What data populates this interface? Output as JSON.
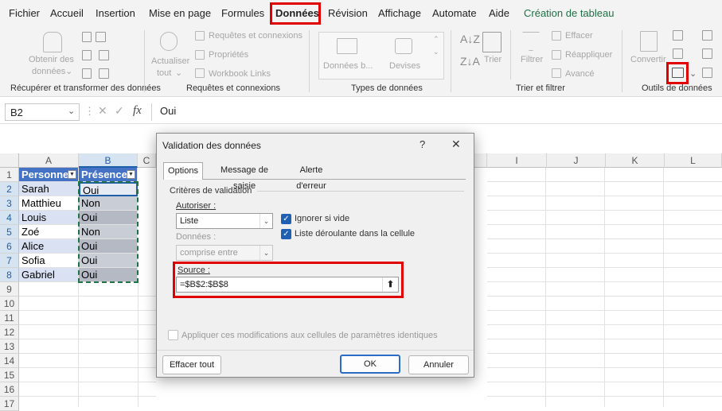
{
  "menu": {
    "items": [
      "Fichier",
      "Accueil",
      "Insertion",
      "Mise en page",
      "Formules",
      "Données",
      "Révision",
      "Affichage",
      "Automate",
      "Aide",
      "Création de tableau"
    ],
    "active": "Données"
  },
  "ribbon": {
    "get_data": "Obtenir des",
    "get_data2": "données",
    "refresh": "Actualiser",
    "refresh2": "tout",
    "queries": "Requêtes et connexions",
    "properties": "Propriétés",
    "workbook_links": "Workbook Links",
    "stocks": "Données b...",
    "currencies": "Devises",
    "sort": "Trier",
    "filter": "Filtrer",
    "clear": "Effacer",
    "reapply": "Réappliquer",
    "advanced": "Avancé",
    "convert": "Convertir",
    "groups": {
      "get_transform": "Récupérer et transformer des données",
      "queries": "Requêtes et connexions",
      "data_types": "Types de données",
      "sort_filter": "Trier et filtrer",
      "data_tools": "Outils de données"
    }
  },
  "formula_bar": {
    "name_box": "B2",
    "fx": "fx",
    "value": "Oui"
  },
  "grid": {
    "columns": [
      "A",
      "B",
      "C",
      "D",
      "E",
      "F",
      "G",
      "H",
      "I",
      "J",
      "K",
      "L"
    ],
    "rows": [
      "1",
      "2",
      "3",
      "4",
      "5",
      "6",
      "7",
      "8",
      "9",
      "10",
      "11",
      "12",
      "13",
      "14",
      "15",
      "16",
      "17"
    ],
    "header": [
      "Personne",
      "Présence"
    ],
    "data": [
      [
        "Sarah",
        "Oui"
      ],
      [
        "Matthieu",
        "Non"
      ],
      [
        "Louis",
        "Oui"
      ],
      [
        "Zoé",
        "Non"
      ],
      [
        "Alice",
        "Oui"
      ],
      [
        "Sofia",
        "Oui"
      ],
      [
        "Gabriel",
        "Oui"
      ]
    ]
  },
  "dialog": {
    "title": "Validation des données",
    "help": "?",
    "close": "✕",
    "tabs": [
      "Options",
      "Message de saisie",
      "Alerte d'erreur"
    ],
    "criteria_label": "Critères de validation",
    "allow_label": "Autoriser :",
    "allow_value": "Liste",
    "data_label": "Données :",
    "data_value": "comprise entre",
    "ignore_blank": "Ignorer si vide",
    "dropdown": "Liste déroulante dans la cellule",
    "source_label": "Source :",
    "source_value": "=$B$2:$B$8",
    "apply_all": "Appliquer ces modifications aux cellules de paramètres identiques",
    "clear_all": "Effacer tout",
    "ok": "OK",
    "cancel": "Annuler"
  },
  "colors": {
    "highlight": "#e00000",
    "table_header": "#4472c4",
    "band": "#d9e1f2",
    "green_tab": "#1e7145"
  }
}
